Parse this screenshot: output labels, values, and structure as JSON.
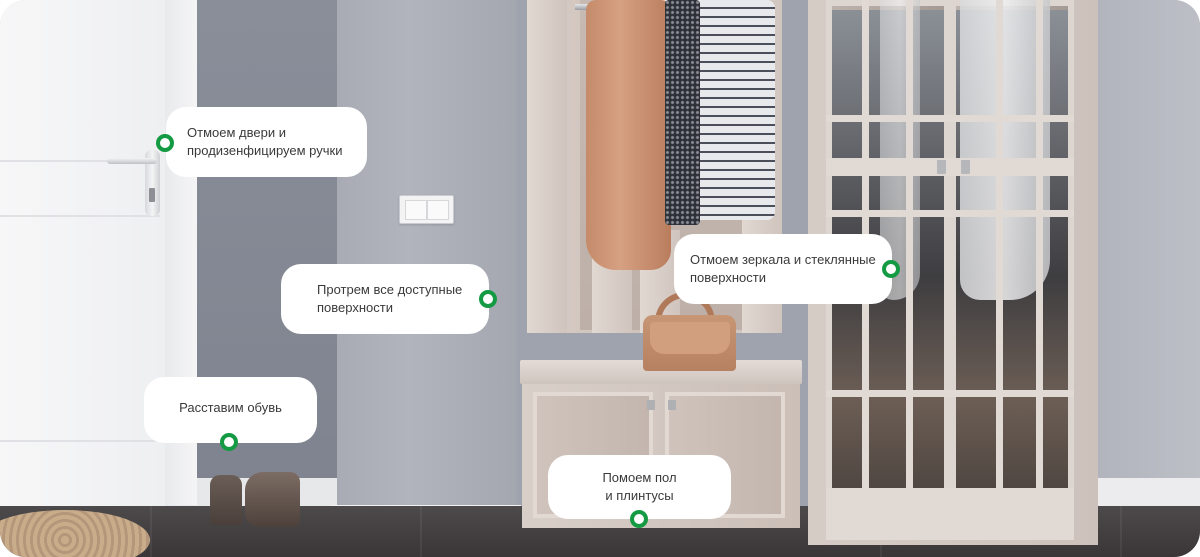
{
  "colors": {
    "marker_ring": "#139a43",
    "callout_background": "#ffffff",
    "callout_text": "#3a3a3a"
  },
  "callouts": {
    "doors": {
      "line1": "Отмоем двери и",
      "line2": "продизенфицируем ручки"
    },
    "surfaces": {
      "line1": "Протрем все доступные",
      "line2": "поверхности"
    },
    "shoes": {
      "line1": "Расставим обувь"
    },
    "mirrors": {
      "line1": "Отмоем зеркала и стеклянные",
      "line2": "поверхности"
    },
    "floor": {
      "line1": "Помоем пол",
      "line2": "и плинтусы"
    }
  }
}
